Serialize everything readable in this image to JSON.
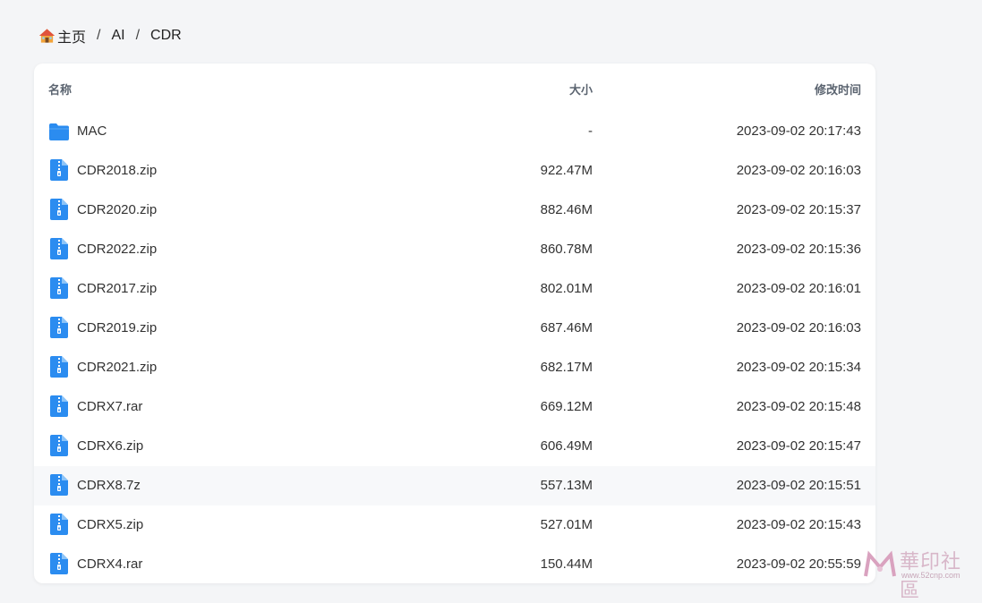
{
  "breadcrumb": {
    "home": "主页",
    "items": [
      "AI",
      "CDR"
    ],
    "separator": "/"
  },
  "columns": {
    "name": "名称",
    "size": "大小",
    "time": "修改时间"
  },
  "files": [
    {
      "icon": "folder-icon",
      "name": "MAC",
      "size": "-",
      "time": "2023-09-02 20:17:43"
    },
    {
      "icon": "zip-file-icon",
      "name": "CDR2018.zip",
      "size": "922.47M",
      "time": "2023-09-02 20:16:03"
    },
    {
      "icon": "zip-file-icon",
      "name": "CDR2020.zip",
      "size": "882.46M",
      "time": "2023-09-02 20:15:37"
    },
    {
      "icon": "zip-file-icon",
      "name": "CDR2022.zip",
      "size": "860.78M",
      "time": "2023-09-02 20:15:36"
    },
    {
      "icon": "zip-file-icon",
      "name": "CDR2017.zip",
      "size": "802.01M",
      "time": "2023-09-02 20:16:01"
    },
    {
      "icon": "zip-file-icon",
      "name": "CDR2019.zip",
      "size": "687.46M",
      "time": "2023-09-02 20:16:03"
    },
    {
      "icon": "zip-file-icon",
      "name": "CDR2021.zip",
      "size": "682.17M",
      "time": "2023-09-02 20:15:34"
    },
    {
      "icon": "zip-file-icon",
      "name": "CDRX7.rar",
      "size": "669.12M",
      "time": "2023-09-02 20:15:48"
    },
    {
      "icon": "zip-file-icon",
      "name": "CDRX6.zip",
      "size": "606.49M",
      "time": "2023-09-02 20:15:47"
    },
    {
      "icon": "zip-file-icon",
      "name": "CDRX8.7z",
      "size": "557.13M",
      "time": "2023-09-02 20:15:51"
    },
    {
      "icon": "zip-file-icon",
      "name": "CDRX5.zip",
      "size": "527.01M",
      "time": "2023-09-02 20:15:43"
    },
    {
      "icon": "zip-file-icon",
      "name": "CDRX4.rar",
      "size": "150.44M",
      "time": "2023-09-02 20:55:59"
    }
  ],
  "watermark": {
    "title": "華印社區",
    "url": "www.52cnp.com"
  },
  "colors": {
    "accent": "#1e88e5",
    "folder": "#2b8cf0",
    "row_hover": "#f7f8fa"
  }
}
